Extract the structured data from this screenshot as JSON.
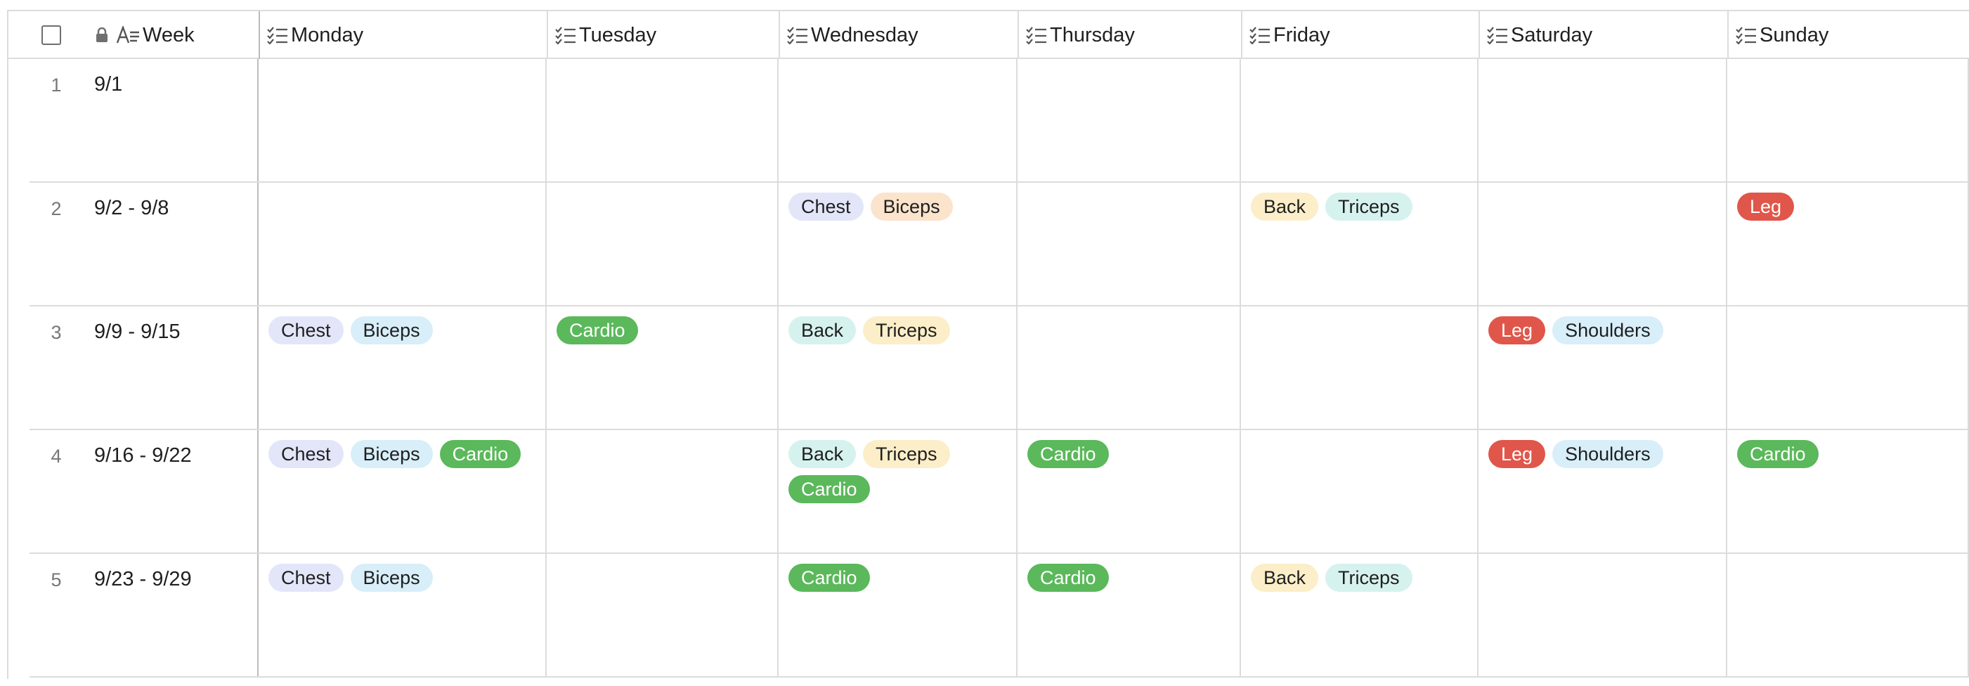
{
  "header": {
    "week": "Week",
    "days": [
      "Monday",
      "Tuesday",
      "Wednesday",
      "Thursday",
      "Friday",
      "Saturday",
      "Sunday"
    ]
  },
  "rows": [
    {
      "num": "1",
      "week": "9/1",
      "cells": [
        [],
        [],
        [],
        [],
        [],
        [],
        []
      ]
    },
    {
      "num": "2",
      "week": "9/2 - 9/8",
      "cells": [
        [],
        [],
        [
          [
            "Chest",
            "t-chest"
          ],
          [
            "Biceps",
            "t-biceps-a"
          ]
        ],
        [],
        [
          [
            "Back",
            "t-back-y"
          ],
          [
            "Triceps",
            "t-triceps"
          ]
        ],
        [],
        [
          [
            "Leg",
            "t-leg"
          ]
        ]
      ]
    },
    {
      "num": "3",
      "week": "9/9 - 9/15",
      "cells": [
        [
          [
            "Chest",
            "t-chest"
          ],
          [
            "Biceps",
            "t-biceps-b"
          ]
        ],
        [
          [
            "Cardio",
            "t-cardio"
          ]
        ],
        [
          [
            "Back",
            "t-back"
          ],
          [
            "Triceps",
            "t-triceps-y"
          ]
        ],
        [],
        [],
        [
          [
            "Leg",
            "t-leg"
          ],
          [
            "Shoulders",
            "t-shoulders"
          ]
        ],
        []
      ]
    },
    {
      "num": "4",
      "week": "9/16 - 9/22",
      "cells": [
        [
          [
            "Chest",
            "t-chest"
          ],
          [
            "Biceps",
            "t-biceps-b"
          ],
          [
            "Cardio",
            "t-cardio"
          ]
        ],
        [],
        [
          [
            "Back",
            "t-back"
          ],
          [
            "Triceps",
            "t-triceps-y"
          ],
          [
            "Cardio",
            "t-cardio"
          ]
        ],
        [
          [
            "Cardio",
            "t-cardio"
          ]
        ],
        [],
        [
          [
            "Leg",
            "t-leg"
          ],
          [
            "Shoulders",
            "t-shoulders"
          ]
        ],
        [
          [
            "Cardio",
            "t-cardio"
          ]
        ]
      ]
    },
    {
      "num": "5",
      "week": "9/23 - 9/29",
      "cells": [
        [
          [
            "Chest",
            "t-chest"
          ],
          [
            "Biceps",
            "t-biceps-b"
          ]
        ],
        [],
        [
          [
            "Cardio",
            "t-cardio"
          ]
        ],
        [
          [
            "Cardio",
            "t-cardio"
          ]
        ],
        [
          [
            "Back",
            "t-back-y"
          ],
          [
            "Triceps",
            "t-triceps"
          ]
        ],
        [],
        []
      ]
    }
  ]
}
